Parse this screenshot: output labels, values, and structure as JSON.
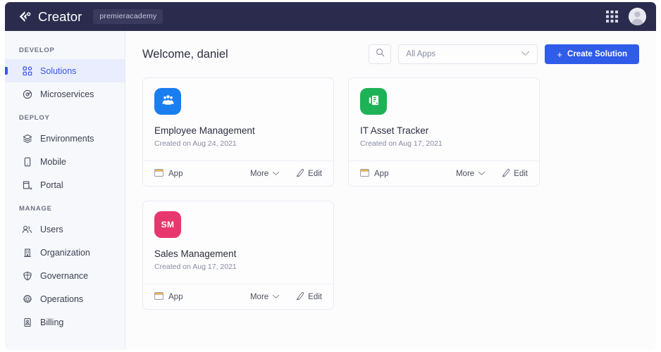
{
  "topbar": {
    "brand_name": "Creator",
    "workspace_badge": "premieracademy",
    "logo_icon": "creator-logo-icon",
    "apps_grid_icon": "apps-grid-icon",
    "avatar_icon": "user-avatar"
  },
  "sidebar": {
    "groups": [
      {
        "label": "DEVELOP",
        "items": [
          {
            "label": "Solutions",
            "icon": "grid-squares-icon",
            "active": true
          },
          {
            "label": "Microservices",
            "icon": "microservice-node-icon",
            "active": false
          }
        ]
      },
      {
        "label": "DEPLOY",
        "items": [
          {
            "label": "Environments",
            "icon": "layers-icon",
            "active": false
          },
          {
            "label": "Mobile",
            "icon": "mobile-phone-icon",
            "active": false
          },
          {
            "label": "Portal",
            "icon": "portal-window-icon",
            "active": false
          }
        ]
      },
      {
        "label": "MANAGE",
        "items": [
          {
            "label": "Users",
            "icon": "users-icon",
            "active": false
          },
          {
            "label": "Organization",
            "icon": "building-icon",
            "active": false
          },
          {
            "label": "Governance",
            "icon": "shield-icon",
            "active": false
          },
          {
            "label": "Operations",
            "icon": "gear-icon",
            "active": false
          },
          {
            "label": "Billing",
            "icon": "billing-card-icon",
            "active": false
          }
        ]
      }
    ]
  },
  "main": {
    "welcome_text": "Welcome, daniel",
    "search_icon": "search-icon",
    "apps_filter": {
      "value": "All Apps",
      "chevron_icon": "chevron-down-icon"
    },
    "create_button": {
      "label": "Create Solution",
      "plus_icon": "plus-icon"
    },
    "solutions": [
      {
        "title": "Employee Management",
        "created": "Created on Aug 24, 2021",
        "icon_type": "glyph",
        "icon_glyph": "people-group-icon",
        "icon_color": "#1a7ef0",
        "initials": "",
        "type_label": "App",
        "type_icon": "app-window-icon",
        "more_label": "More",
        "more_icon": "chevron-down-icon",
        "edit_label": "Edit",
        "edit_icon": "pencil-icon"
      },
      {
        "title": "IT Asset Tracker",
        "created": "Created on Aug 17, 2021",
        "icon_type": "glyph",
        "icon_glyph": "server-asset-icon",
        "icon_color": "#1eb256",
        "initials": "",
        "type_label": "App",
        "type_icon": "app-window-icon",
        "more_label": "More",
        "more_icon": "chevron-down-icon",
        "edit_label": "Edit",
        "edit_icon": "pencil-icon"
      },
      {
        "title": "Sales Management",
        "created": "Created on Aug 17, 2021",
        "icon_type": "initials",
        "icon_glyph": "",
        "icon_color": "#e8376f",
        "initials": "SM",
        "type_label": "App",
        "type_icon": "app-window-icon",
        "more_label": "More",
        "more_icon": "chevron-down-icon",
        "edit_label": "Edit",
        "edit_icon": "pencil-icon"
      }
    ]
  },
  "colors": {
    "topbar_bg": "#2b2c4d",
    "accent_blue": "#2f5ce8",
    "sidebar_bg": "#f7f8fb",
    "active_item_bg": "#e9edfd"
  }
}
